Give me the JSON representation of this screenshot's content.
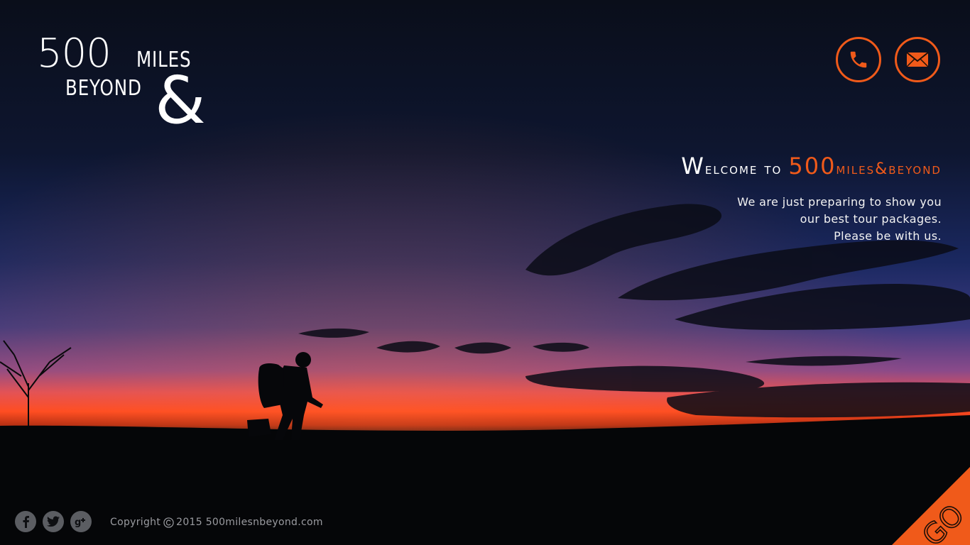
{
  "logo": {
    "num": "500",
    "miles": "MILES",
    "beyond": "BEYOND",
    "amp": "&"
  },
  "header": {
    "phone_icon": "phone-icon",
    "mail_icon": "mail-icon"
  },
  "welcome": {
    "title_prefix_big": "W",
    "title_prefix": "elcome to ",
    "brand_big": "500",
    "brand_rest": "miles&beyond",
    "lines": [
      "We are just preparing to show you",
      "our best tour  packages.",
      "Please be with us."
    ]
  },
  "footer": {
    "social": [
      "facebook-icon",
      "twitter-icon",
      "google-plus-icon"
    ],
    "copyright_word": "Copyright",
    "copyright_rest": "2015 500milesnbeyond.com"
  },
  "corner": {
    "label": "GO"
  },
  "colors": {
    "accent": "#f05a1a",
    "social_bg": "#5b5d62"
  }
}
